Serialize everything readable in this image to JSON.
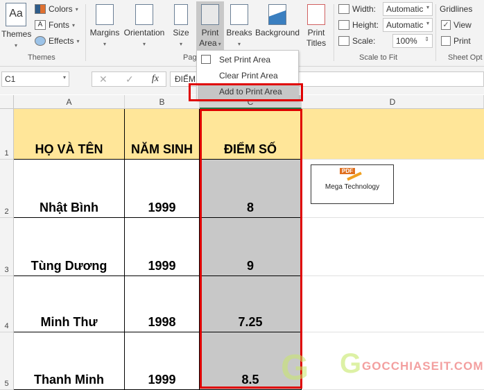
{
  "ribbon": {
    "themes": {
      "themes": "Themes",
      "colors": "Colors",
      "fonts": "Fonts",
      "effects": "Effects",
      "group": "Themes"
    },
    "page_setup": {
      "margins": "Margins",
      "orientation": "Orientation",
      "size": "Size",
      "print_area_1": "Print",
      "print_area_2": "Area",
      "breaks": "Breaks",
      "background": "Background",
      "print_titles_1": "Print",
      "print_titles_2": "Titles",
      "group": "Pag"
    },
    "scale": {
      "width_label": "Width:",
      "width_value": "Automatic",
      "height_label": "Height:",
      "height_value": "Automatic",
      "scale_label": "Scale:",
      "scale_value": "100%",
      "group": "Scale to Fit"
    },
    "sheet_options": {
      "gridlines": "Gridlines",
      "view": "View",
      "view_checked": true,
      "print": "Print",
      "print_checked": false,
      "group": "Sheet Opt"
    }
  },
  "print_area_menu": {
    "items": [
      "Set Print Area",
      "Clear Print Area",
      "Add to Print Area"
    ],
    "highlighted": "Add to Print Area"
  },
  "formula_bar": {
    "name_box": "C1",
    "fx": "fx",
    "content": "ĐIỂM SỐ",
    "cancel": "✕",
    "enter": "✓"
  },
  "columns": [
    "A",
    "B",
    "C",
    "D"
  ],
  "rows": [
    {
      "num": "1",
      "cells": [
        "HỌ VÀ TÊN",
        "NĂM SINH",
        "ĐIỂM SỐ"
      ]
    },
    {
      "num": "2",
      "cells": [
        "Nhật Bình",
        "1999",
        "8"
      ]
    },
    {
      "num": "3",
      "cells": [
        "Tùng Dương",
        "1999",
        "9"
      ]
    },
    {
      "num": "4",
      "cells": [
        "Minh Thư",
        "1998",
        "7.25"
      ]
    },
    {
      "num": "5",
      "cells": [
        "Thanh Minh",
        "1999",
        "8.5"
      ]
    }
  ],
  "image": {
    "badge": "PDF",
    "caption": "Mega Technology"
  },
  "watermark": "GOCCHIASEIT.COM",
  "colors": {
    "header_fill": "#ffe699",
    "selection": "#c8c8c8",
    "highlight_box": "#e00000"
  }
}
